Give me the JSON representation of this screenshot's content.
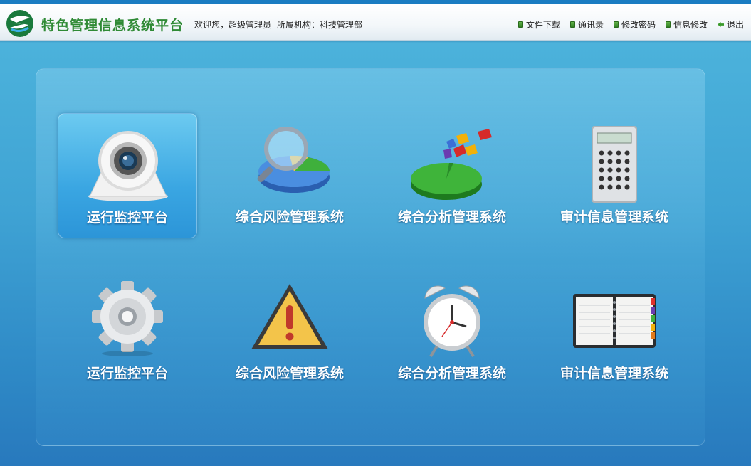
{
  "header": {
    "app_title": "特色管理信息系统平台",
    "welcome": "欢迎您，超级管理员",
    "org": "所属机构：科技管理部",
    "links": [
      {
        "label": "文件下载",
        "icon": "green-bullet-icon"
      },
      {
        "label": "通讯录",
        "icon": "green-bullet-icon"
      },
      {
        "label": "修改密码",
        "icon": "green-bullet-icon"
      },
      {
        "label": "信息修改",
        "icon": "green-bullet-icon"
      },
      {
        "label": "退出",
        "icon": "exit-arrow-icon"
      }
    ]
  },
  "tiles": [
    {
      "label": "运行监控平台",
      "icon": "webcam-icon",
      "active": true
    },
    {
      "label": "综合风险管理系统",
      "icon": "magnifier-pie-icon",
      "active": false
    },
    {
      "label": "综合分析管理系统",
      "icon": "pie-chart-icon",
      "active": false
    },
    {
      "label": "审计信息管理系统",
      "icon": "calculator-icon",
      "active": false
    },
    {
      "label": "运行监控平台",
      "icon": "gear-icon",
      "active": false
    },
    {
      "label": "综合风险管理系统",
      "icon": "warning-icon",
      "active": false
    },
    {
      "label": "综合分析管理系统",
      "icon": "alarm-clock-icon",
      "active": false
    },
    {
      "label": "审计信息管理系统",
      "icon": "notebook-icon",
      "active": false
    }
  ],
  "colors": {
    "accent": "#1b7dc2",
    "title_green": "#2f8a35",
    "active_tile": "#3aa6e2"
  }
}
